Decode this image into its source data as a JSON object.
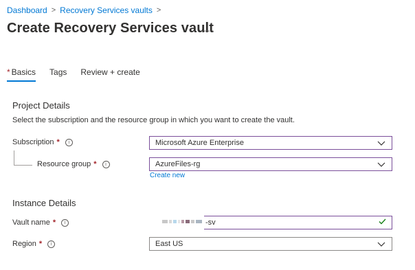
{
  "breadcrumb": {
    "items": [
      "Dashboard",
      "Recovery Services vaults"
    ],
    "separator": ">"
  },
  "page": {
    "title": "Create Recovery Services vault",
    "more_label": "···"
  },
  "tabs": [
    {
      "label": "Basics",
      "required_mark": "*",
      "active": true
    },
    {
      "label": "Tags",
      "active": false
    },
    {
      "label": "Review + create",
      "active": false
    }
  ],
  "project": {
    "heading": "Project Details",
    "description": "Select the subscription and the resource group in which you want to create the vault.",
    "subscription": {
      "label": "Subscription",
      "required_mark": "*",
      "value": "Microsoft Azure Enterprise"
    },
    "resource_group": {
      "label": "Resource group",
      "required_mark": "*",
      "value": "AzureFiles-rg",
      "create_new": "Create new"
    }
  },
  "instance": {
    "heading": "Instance Details",
    "vault_name": {
      "label": "Vault name",
      "required_mark": "*",
      "value_suffix": "-sv",
      "valid": true
    },
    "region": {
      "label": "Region",
      "required_mark": "*",
      "value": "East US"
    }
  },
  "colors": {
    "accent": "#0078d4",
    "required": "#a4262c",
    "focus_border": "#7a4e9a",
    "valid_check": "#107c10"
  },
  "icons": {
    "info": "info-circle-icon",
    "dropdown": "chevron-down-icon",
    "valid": "checkmark-icon",
    "crumb_sep": "chevron-right-icon"
  }
}
